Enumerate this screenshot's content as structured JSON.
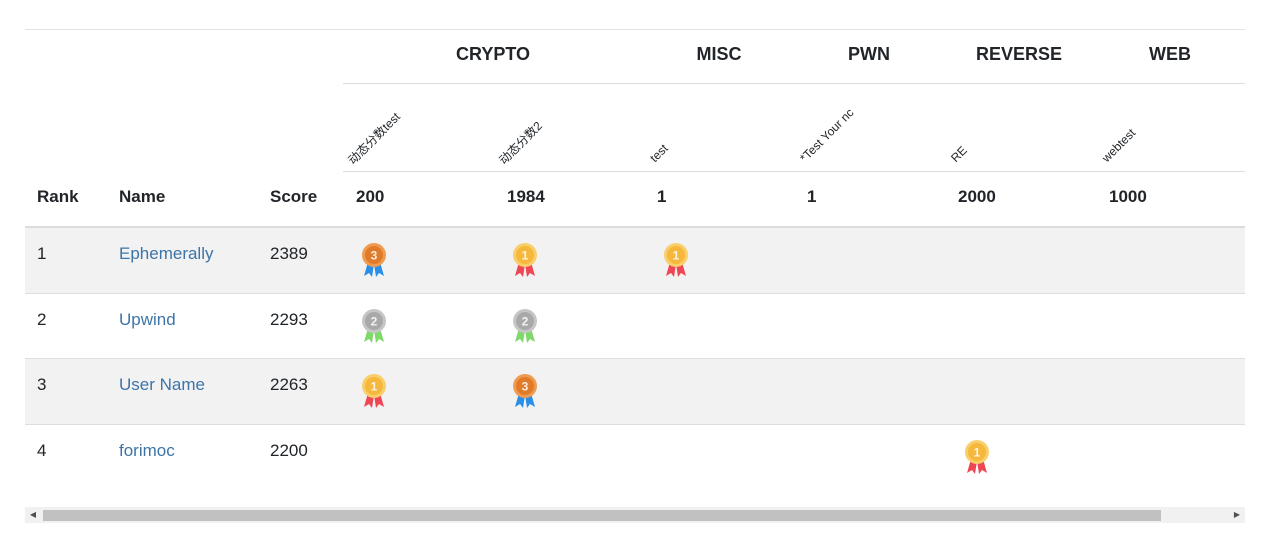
{
  "categories": [
    "CRYPTO",
    "MISC",
    "PWN",
    "REVERSE",
    "WEB"
  ],
  "challenges": [
    {
      "name": "动态分数test",
      "points": "200"
    },
    {
      "name": "动态分数2",
      "points": "1984"
    },
    {
      "name": "test",
      "points": "1"
    },
    {
      "name": "*Test Your nc",
      "points": "1"
    },
    {
      "name": "RE",
      "points": "2000"
    },
    {
      "name": "webtest",
      "points": "1000"
    }
  ],
  "columns": {
    "rank": "Rank",
    "name": "Name",
    "score": "Score"
  },
  "rows": [
    {
      "rank": "1",
      "name": "Ephemerally",
      "score": "2389",
      "medals": [
        3,
        1,
        1,
        0,
        0,
        0
      ]
    },
    {
      "rank": "2",
      "name": "Upwind",
      "score": "2293",
      "medals": [
        2,
        2,
        0,
        0,
        0,
        0
      ]
    },
    {
      "rank": "3",
      "name": "User Name",
      "score": "2263",
      "medals": [
        1,
        3,
        0,
        0,
        0,
        0
      ]
    },
    {
      "rank": "4",
      "name": "forimoc",
      "score": "2200",
      "medals": [
        0,
        0,
        0,
        0,
        1,
        0
      ]
    }
  ],
  "medal_colors": {
    "gold": "#f5b83d",
    "silver": "#a9a9a9",
    "bronze": "#e07b2a",
    "gold_ribbon": "#ef4655",
    "silver_ribbon": "#7fd86a",
    "bronze_ribbon": "#2a8fe8"
  },
  "icons": {
    "medal": "medal-icon",
    "scroll_left": "triangle-left-icon",
    "scroll_right": "triangle-right-icon"
  }
}
